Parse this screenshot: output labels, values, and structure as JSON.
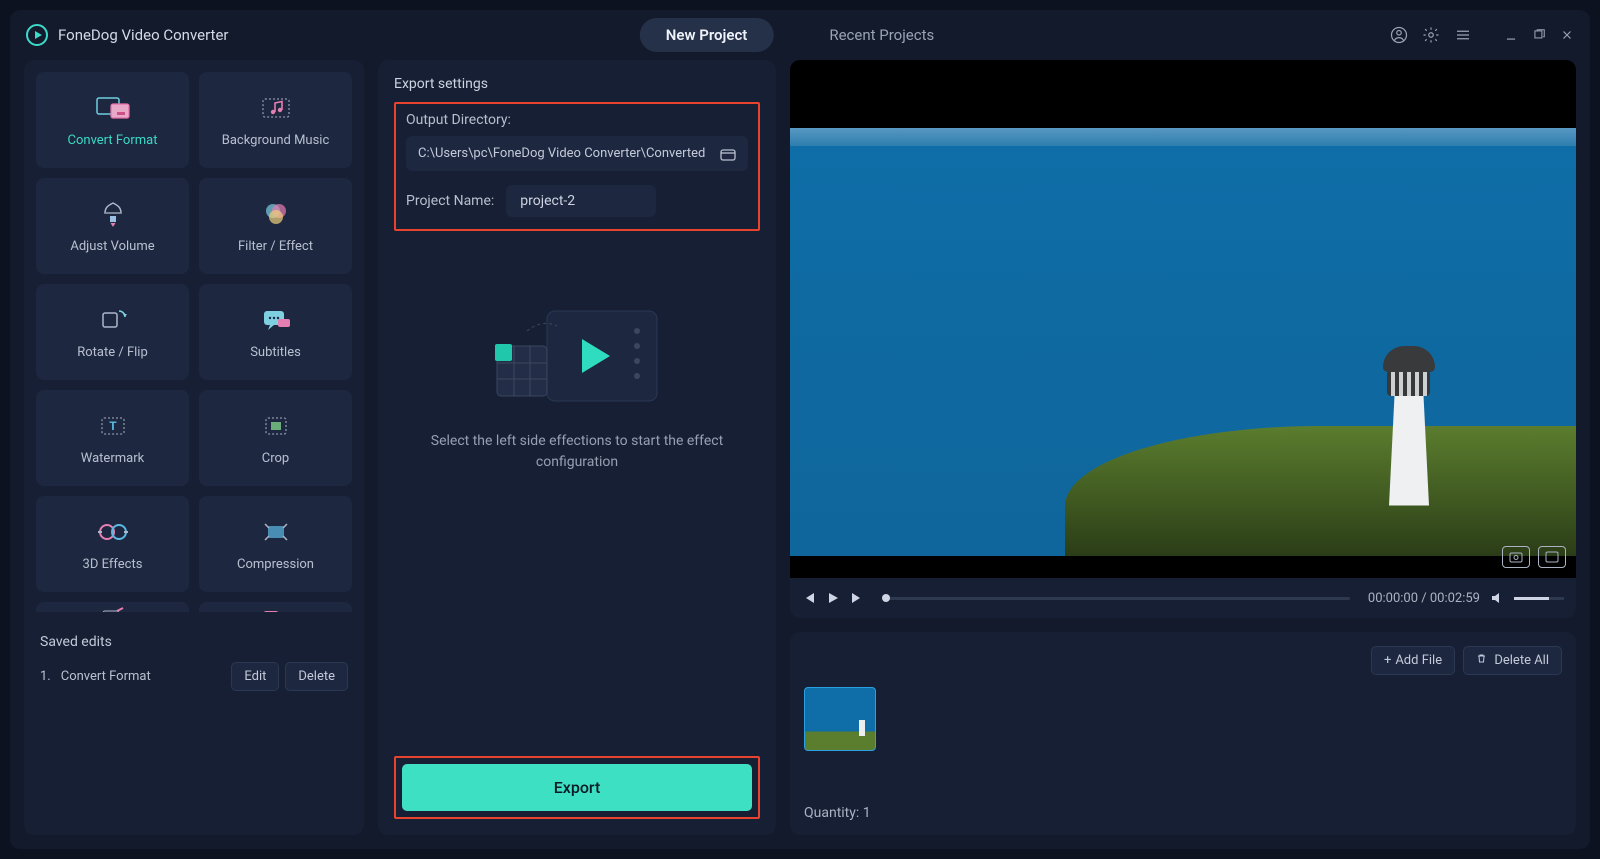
{
  "app": {
    "title": "FoneDog Video Converter"
  },
  "tabs": {
    "new_project": "New Project",
    "recent_projects": "Recent Projects"
  },
  "sidebar": {
    "cards": [
      {
        "name": "convert-format",
        "label": "Convert Format"
      },
      {
        "name": "background-music",
        "label": "Background Music"
      },
      {
        "name": "adjust-volume",
        "label": "Adjust Volume"
      },
      {
        "name": "filter-effect",
        "label": "Filter / Effect"
      },
      {
        "name": "rotate-flip",
        "label": "Rotate / Flip"
      },
      {
        "name": "subtitles",
        "label": "Subtitles"
      },
      {
        "name": "watermark",
        "label": "Watermark"
      },
      {
        "name": "crop",
        "label": "Crop"
      },
      {
        "name": "3d-effects",
        "label": "3D Effects"
      },
      {
        "name": "compression",
        "label": "Compression"
      }
    ],
    "saved_title": "Saved edits",
    "saved_items": [
      {
        "index": "1.",
        "label": "Convert Format"
      }
    ],
    "edit_label": "Edit",
    "delete_label": "Delete"
  },
  "export": {
    "settings_title": "Export settings",
    "output_dir_label": "Output Directory:",
    "output_dir_value": "C:\\Users\\pc\\FoneDog Video Converter\\Converted",
    "project_name_label": "Project Name:",
    "project_name_value": "project-2",
    "hint": "Select the left side effections to start the effect configuration",
    "button": "Export"
  },
  "player": {
    "time_current": "00:00:00",
    "time_total": "00:02:59"
  },
  "queue": {
    "add_file": "Add File",
    "delete_all": "Delete All",
    "quantity_label": "Quantity:",
    "quantity_value": "1"
  }
}
